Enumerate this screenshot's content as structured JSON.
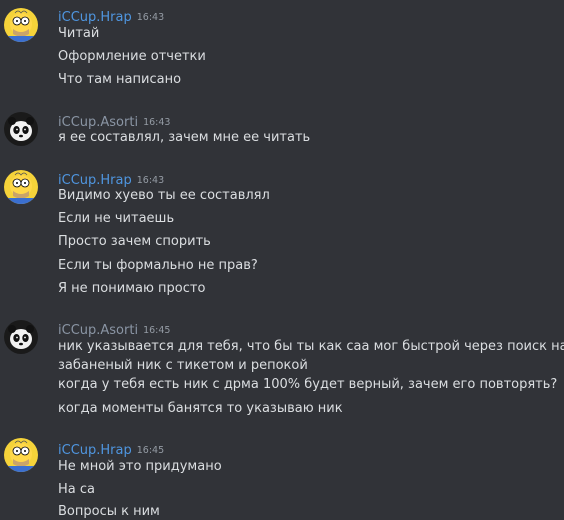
{
  "messages": [
    {
      "author": "iCCup.Hrap",
      "time": "16:43",
      "avatar": "homer-simpson-avatar",
      "lines": [
        "Читай",
        "Оформление отчетки",
        "Что там написано"
      ]
    },
    {
      "author": "iCCup.Asorti",
      "time": "16:43",
      "avatar": "panda-avatar",
      "lines": [
        "я ее составлял, зачем мне ее читать"
      ]
    },
    {
      "author": "iCCup.Hrap",
      "time": "16:43",
      "avatar": "homer-simpson-avatar",
      "lines": [
        "Видимо хуево ты ее составлял",
        "Если не читаешь",
        "Просто зачем спорить",
        "Если ты формально не прав?",
        "Я не понимаю просто"
      ]
    },
    {
      "author": "iCCup.Asorti",
      "time": "16:45",
      "avatar": "panda-avatar",
      "lines": [
        "ник указывается для тебя, что бы ты как саа мог быстрой через поиск найти",
        "забаненый ник с тикетом и репокой",
        "когда у тебя есть ник с дрма 100% будет верный, зачем его повторять?",
        "когда моменты банятся то указываю ник"
      ]
    },
    {
      "author": "iCCup.Hrap",
      "time": "16:45",
      "avatar": "homer-simpson-avatar",
      "lines": [
        "Не мной это придумано",
        "На са",
        "Вопросы к ним"
      ]
    }
  ],
  "colors": {
    "background": "#313338",
    "hrap_name": "#4f96e0",
    "asorti_name": "#8a95a4",
    "text": "#dbdee1",
    "timestamp": "#949ba4"
  }
}
